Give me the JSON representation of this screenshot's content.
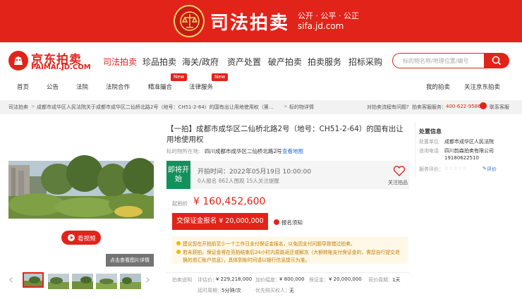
{
  "banner": {
    "title": "司法拍卖",
    "slogan": "公开 · 公平 · 公正",
    "site": "sifa.jd.com"
  },
  "logo": {
    "name": "京东拍卖",
    "domain": "PAIMAI.JD.COM"
  },
  "main_nav": [
    "司法拍卖",
    "珍品拍卖",
    "海关/政府",
    "资产处置",
    "破产拍卖",
    "拍卖服务",
    "招标采购"
  ],
  "search": {
    "placeholder": "标的物名称/地理位置/编号"
  },
  "sub_nav": [
    "首页",
    "公告",
    "法院",
    "法院合作",
    "精准撮合",
    "法律服务"
  ],
  "new_badge": "New",
  "user_links": {
    "my_auction": "我的拍卖",
    "follow": "关注京东拍卖"
  },
  "breadcrumb": {
    "items": [
      "司法拍卖",
      "成都市成华区人民法院关于成都市成华区二仙桥北路2号（地号：CH51-2-64）的国有出让用地使用权（第...",
      "标的物详情"
    ],
    "help": "对拍卖流程有问题?",
    "service": "拍卖客服服务：",
    "phone": "400-622-9586",
    "contact": "联系客服"
  },
  "gallery": {
    "video_label": "看视频",
    "view_large": "点击查看图片详情"
  },
  "item": {
    "title": "【一拍】成都市成华区二仙桥北路2号（地号：CH51-2-64）的国有出让用地使用权",
    "location_label": "标的物所在地:",
    "location": "四川成都市成华区二仙桥北路2号",
    "map_link": "查看地图"
  },
  "bid": {
    "badge": "即将开始",
    "start_time": "开拍时间：2022年05月19日 10:00:00",
    "stats": "0人报名   862人围观   15人关注提醒",
    "follow_label": "关注拍品",
    "price_label": "起拍价",
    "price": "¥ 160,452,600",
    "deposit_button": "交保证金报名 ¥ 20,000,000",
    "register_notice": "报名须知"
  },
  "tips": [
    "建议您在开拍前至少一个工作日支付保证金报名，以免因支付问题导致错过拍卖。",
    "若未获拍，保证金将在竞拍结束后24小时内原路返还或解冻（大额转账支付保证金的，需您自行提交退",
    "换的退汇账户信息），具体到账时间请以银行信息提示为准。"
  ],
  "params": {
    "label": "拍卖说明",
    "row1": [
      "评估价：",
      "¥ 229,218,000",
      "加价幅度：",
      "¥ 800,000",
      "保证金：",
      "¥ 20,000,000",
      "竞价周期：",
      "1天"
    ],
    "row2": [
      "延时周期：",
      "5分钟/次",
      "优先购买权人：",
      "无"
    ]
  },
  "sidebar": {
    "header": "处置信息",
    "court_label": "处置单位",
    "court": "成都市成华区人民法院",
    "agency_label": "咨询电话",
    "agency": "四川韵森拍卖有限公司",
    "phone": "19180622510",
    "rating_label": "服务评价：",
    "rate_link": "评价"
  },
  "colors": {
    "brand_red": "#e2231a",
    "status_green": "#13915d",
    "tip_yellow": "#fff8e6"
  }
}
